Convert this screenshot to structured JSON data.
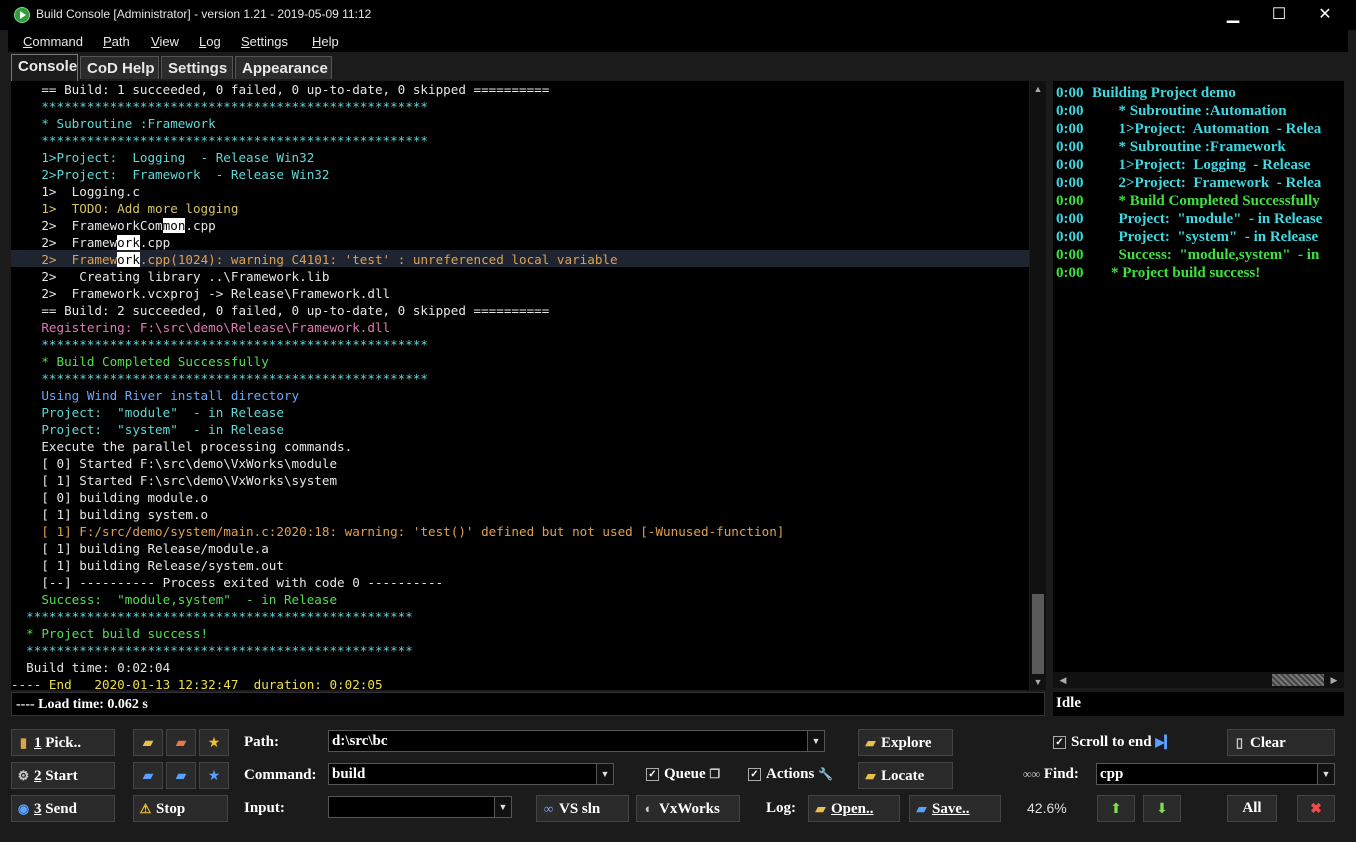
{
  "window": {
    "title": "Build Console [Administrator] - version 1.21 - 2019-05-09 11:12",
    "minimize": "▁",
    "maximize": "☐",
    "close": "✕"
  },
  "menu": [
    {
      "label": "Command",
      "accel": "C",
      "rest": "ommand"
    },
    {
      "label": "Path",
      "accel": "P",
      "rest": "ath"
    },
    {
      "label": "View",
      "accel": "V",
      "rest": "iew"
    },
    {
      "label": "Log",
      "accel": "L",
      "rest": "og"
    },
    {
      "label": "Settings",
      "accel": "S",
      "rest": "ettings"
    },
    {
      "label": "Help",
      "accel": "H",
      "rest": "elp"
    }
  ],
  "tabs": [
    "Console",
    "CoD Help",
    "Settings",
    "Appearance"
  ],
  "colors": {
    "white": "#e6e6e6",
    "cyan": "#5fd7d7",
    "gold": "#d7c35f",
    "orange": "#e0a050",
    "magenta": "#e07ab0",
    "green": "#4fe04f",
    "blue": "#6aa7ff",
    "yellow": "#f0e040",
    "grey": "#bbbbbb",
    "rightcyan": "#3fd7e0",
    "rightgreen": "#3fe03f"
  },
  "console": {
    "lines": [
      {
        "text": "    == Build: 1 succeeded, 0 failed, 0 up-to-date, 0 skipped ==========",
        "color": "white"
      },
      {
        "text": "    ***************************************************",
        "color": "cyan"
      },
      {
        "text": "    * Subroutine :Framework",
        "color": "cyan"
      },
      {
        "text": "    ***************************************************",
        "color": "cyan"
      },
      {
        "text": "    1>Project:  Logging  - Release Win32",
        "color": "cyan"
      },
      {
        "text": "    2>Project:  Framework  - Release Win32",
        "color": "cyan"
      },
      {
        "text": "    1>  Logging.c",
        "color": "white"
      },
      {
        "text": "    1>  TODO: Add more logging",
        "color": "gold"
      },
      {
        "text": "    2>  FrameworkCommon.cpp",
        "color": "white",
        "hl_start": 20,
        "hl_len": 3
      },
      {
        "text": "    2>  Framework.cpp",
        "color": "white",
        "hl_start": 14,
        "hl_len": 3
      },
      {
        "text": "    2>  Framework.cpp(1024): warning C4101: 'test' : unreferenced local variable",
        "color": "orange",
        "hl_start": 14,
        "hl_len": 3,
        "current": true
      },
      {
        "text": "    2>   Creating library ..\\Framework.lib",
        "color": "white"
      },
      {
        "text": "    2>  Framework.vcxproj -> Release\\Framework.dll",
        "color": "white"
      },
      {
        "text": "    == Build: 2 succeeded, 0 failed, 0 up-to-date, 0 skipped ==========",
        "color": "white"
      },
      {
        "text": "    Registering: F:\\src\\demo\\Release\\Framework.dll",
        "color": "magenta"
      },
      {
        "text": "    ***************************************************",
        "color": "cyan"
      },
      {
        "text": "    * Build Completed Successfully",
        "color": "green"
      },
      {
        "text": "    ***************************************************",
        "color": "cyan"
      },
      {
        "text": "    Using Wind River install directory",
        "color": "blue"
      },
      {
        "text": "    Project:  \"module\"  - in Release",
        "color": "cyan"
      },
      {
        "text": "    Project:  \"system\"  - in Release",
        "color": "cyan"
      },
      {
        "text": "    Execute the parallel processing commands.",
        "color": "white"
      },
      {
        "text": "    [ 0] Started F:\\src\\demo\\VxWorks\\module",
        "color": "white"
      },
      {
        "text": "    [ 1] Started F:\\src\\demo\\VxWorks\\system",
        "color": "white"
      },
      {
        "text": "    [ 0] building module.o",
        "color": "white"
      },
      {
        "text": "    [ 1] building system.o",
        "color": "white"
      },
      {
        "text": "    [ 1] F:/src/demo/system/main.c:2020:18: warning: 'test()' defined but not used [-Wunused-function]",
        "color": "orange"
      },
      {
        "text": "    [ 1] building Release/module.a",
        "color": "white"
      },
      {
        "text": "    [ 1] building Release/system.out",
        "color": "white"
      },
      {
        "text": "    [--] ---------- Process exited with code 0 ----------",
        "color": "white"
      },
      {
        "text": "    Success:  \"module,system\"  - in Release",
        "color": "green"
      },
      {
        "text": "  ***************************************************",
        "color": "cyan"
      },
      {
        "text": "  * Project build success!",
        "color": "green"
      },
      {
        "text": "  ***************************************************",
        "color": "cyan"
      },
      {
        "text": "  Build time: 0:02:04",
        "color": "white"
      },
      {
        "text": "---- End   2020-01-13 12:32:47  duration: 0:02:05",
        "color": "yellow"
      }
    ]
  },
  "right_panel": {
    "lines": [
      {
        "time": "0:00",
        "msg": "Building Project demo",
        "color": "rightcyan",
        "inline": true
      },
      {
        "time": "0:00",
        "msg": "  * Subroutine :Automation",
        "color": "rightcyan"
      },
      {
        "time": "0:00",
        "msg": "  1>Project:  Automation  - Relea",
        "color": "rightcyan"
      },
      {
        "time": "0:00",
        "msg": "  * Subroutine :Framework",
        "color": "rightcyan"
      },
      {
        "time": "0:00",
        "msg": "  1>Project:  Logging  - Release",
        "color": "rightcyan"
      },
      {
        "time": "0:00",
        "msg": "  2>Project:  Framework  - Relea",
        "color": "rightcyan"
      },
      {
        "time": "0:00",
        "msg": "  * Build Completed Successfully",
        "color": "rightgreen"
      },
      {
        "time": "0:00",
        "msg": "  Project:  \"module\"  - in Release",
        "color": "rightcyan"
      },
      {
        "time": "0:00",
        "msg": "  Project:  \"system\"  - in Release",
        "color": "rightcyan"
      },
      {
        "time": "0:00",
        "msg": "  Success:  \"module,system\"  - in",
        "color": "rightgreen"
      },
      {
        "time": "0:00",
        "msg": "* Project build success!",
        "color": "rightgreen"
      }
    ]
  },
  "status": {
    "load_time": "---- Load time: 0.062 s",
    "state": "Idle"
  },
  "controls": {
    "pick": {
      "num": "1",
      "label": " Pick.."
    },
    "start": {
      "num": "2",
      "label": " Start"
    },
    "send": {
      "num": "3",
      "label": " Send"
    },
    "stop": "Stop",
    "path_label": "Path:",
    "path_value": "d:\\src\\bc",
    "command_label": "Command:",
    "command_value": "build",
    "input_label": "Input:",
    "input_value": "",
    "explore": "Explore",
    "locate": "Locate",
    "queue": "Queue",
    "actions": "Actions",
    "vs_sln": "VS sln",
    "vxworks": "VxWorks",
    "log_label": "Log:",
    "open": "Open..",
    "save": "Save..",
    "scroll_to_end": "Scroll to end",
    "find_label": "Find:",
    "find_value": "cpp",
    "clear": "Clear",
    "percent": "42.6%",
    "all": "All"
  }
}
